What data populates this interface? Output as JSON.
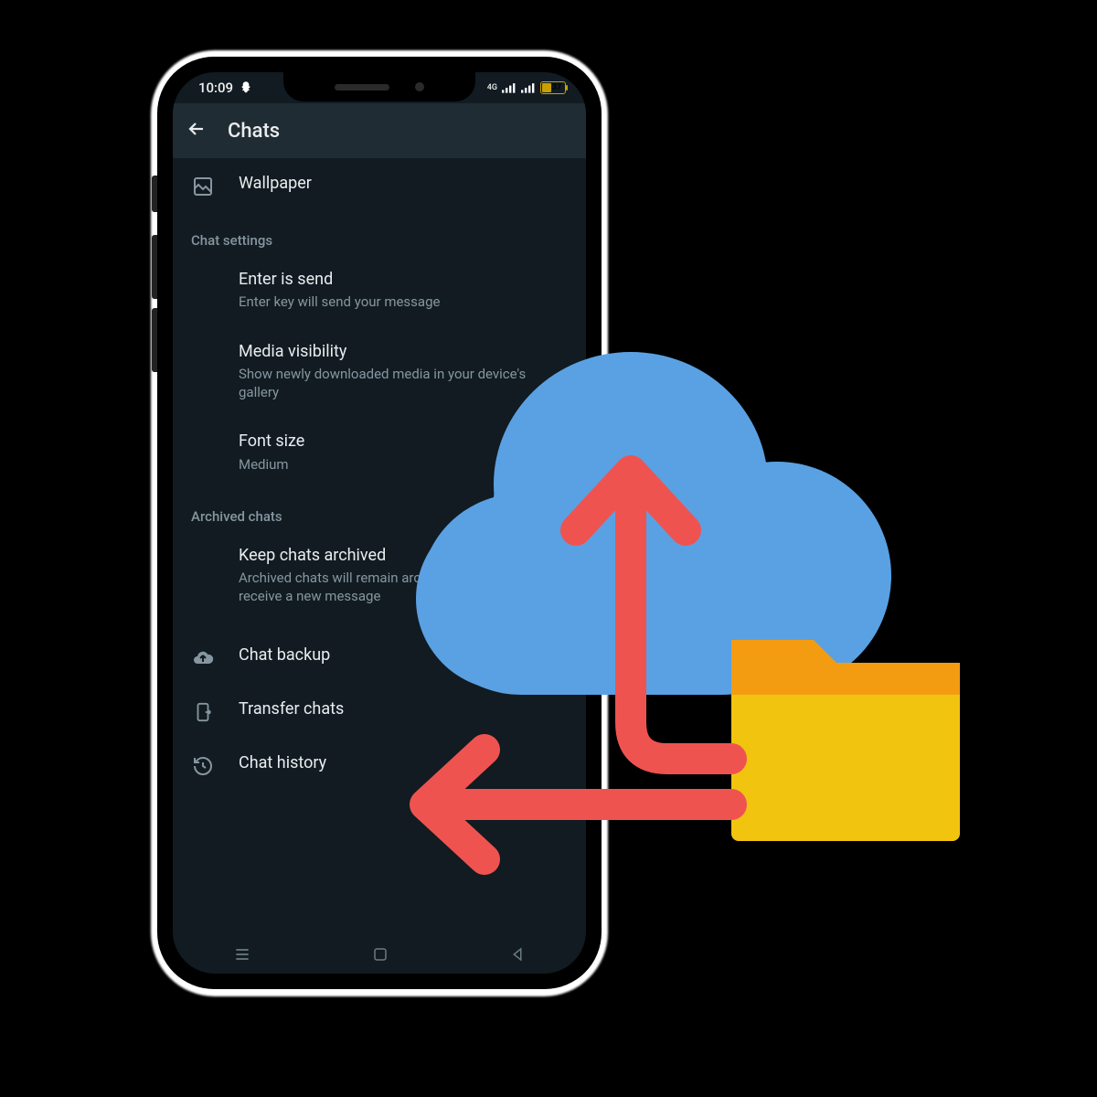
{
  "status": {
    "time": "10:09",
    "net": "4G",
    "battery": "37"
  },
  "header": {
    "title": "Chats"
  },
  "items": {
    "wallpaper": {
      "label": "Wallpaper"
    }
  },
  "sections": {
    "chat_settings": {
      "heading": "Chat settings",
      "enter_send": {
        "label": "Enter is send",
        "sub": "Enter key will send your message"
      },
      "media_vis": {
        "label": "Media visibility",
        "sub": "Show newly downloaded media in your device's gallery"
      },
      "font_size": {
        "label": "Font size",
        "sub": "Medium"
      }
    },
    "archived": {
      "heading": "Archived chats",
      "keep": {
        "label": "Keep chats archived",
        "sub": "Archived chats will remain archived when you receive a new message"
      }
    },
    "bottom": {
      "backup": {
        "label": "Chat backup"
      },
      "transfer": {
        "label": "Transfer chats"
      },
      "history": {
        "label": "Chat history"
      }
    }
  }
}
